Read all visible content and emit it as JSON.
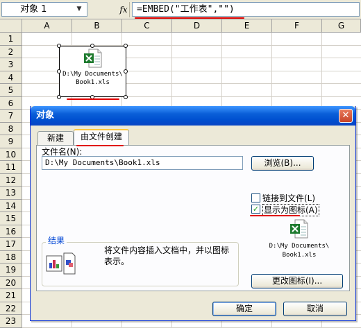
{
  "formula_bar": {
    "name_box": "对象 1",
    "fx_label": "fx",
    "formula": "=EMBED(\"工作表\",\"\")"
  },
  "sheet": {
    "columns": [
      "A",
      "B",
      "C",
      "D",
      "E",
      "F",
      "G"
    ],
    "rows": [
      "1",
      "2",
      "3",
      "4",
      "5",
      "6",
      "7",
      "8",
      "9",
      "10",
      "11",
      "12",
      "13",
      "14",
      "15",
      "16",
      "17",
      "18",
      "19",
      "20",
      "21",
      "22",
      "23"
    ],
    "embedded_object": {
      "line1": "D:\\My Documents\\",
      "line2": "Book1.xls",
      "icon": "excel-file-icon"
    }
  },
  "dialog": {
    "title": "对象",
    "tabs": [
      {
        "label": "新建",
        "active": false
      },
      {
        "label": "由文件创建",
        "active": true
      }
    ],
    "file_name_label": "文件名(N):",
    "file_path": "D:\\My Documents\\Book1.xls",
    "browse_button": "浏览(B)...",
    "link_to_file": {
      "label": "链接到文件(L)",
      "checked": false
    },
    "display_as_icon": {
      "label": "显示为图标(A)",
      "checked": true
    },
    "result": {
      "title": "结果",
      "text": "将文件内容插入文档中，并以图标表示。",
      "icon": "insert-object-result-icon"
    },
    "icon_preview": {
      "line1": "D:\\My Documents\\",
      "line2": "Book1.xls",
      "icon": "excel-file-icon"
    },
    "change_icon_button": "更改图标(I)...",
    "ok_button": "确定",
    "cancel_button": "取消",
    "close_icon": "close-icon"
  },
  "colors": {
    "annotation_red": "#e00000",
    "titlebar_blue": "#0a5fd8",
    "excel_green": "#1d7a2e"
  }
}
